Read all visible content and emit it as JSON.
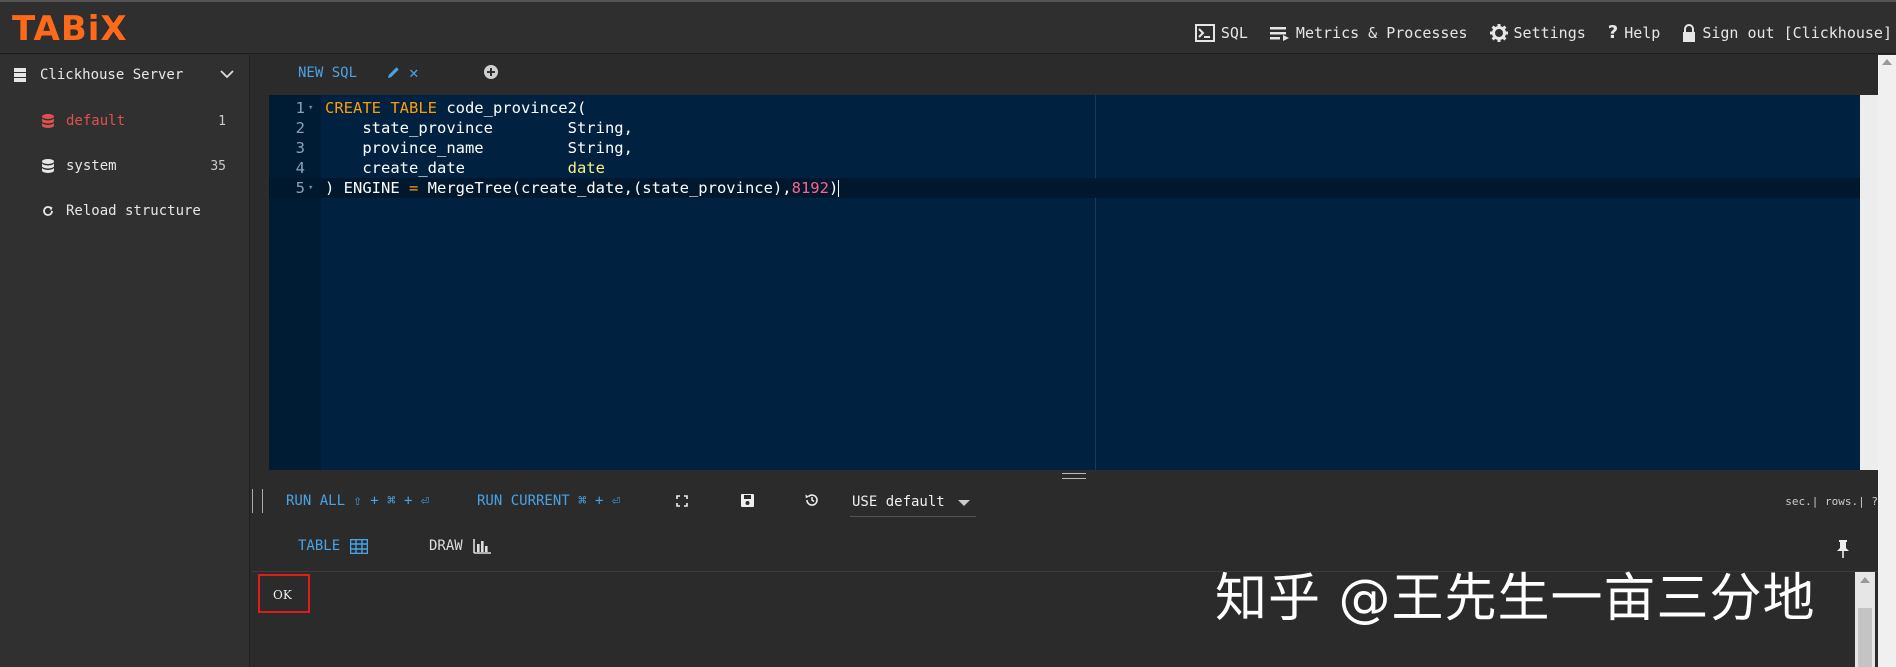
{
  "app": {
    "logo": "TABiX",
    "colors": {
      "brand": "#ff6a1a",
      "accent": "#4aa3e6",
      "danger": "#e05050",
      "editor_bg": "#002240"
    }
  },
  "topnav": {
    "sql": "SQL",
    "metrics": "Metrics & Processes",
    "settings": "Settings",
    "help": "Help",
    "signout": "Sign out [Clickhouse]"
  },
  "sidebar": {
    "server": "Clickhouse Server",
    "databases": [
      {
        "name": "default",
        "count": "1"
      },
      {
        "name": "system",
        "count": "35"
      }
    ],
    "reload": "Reload structure"
  },
  "tabs": {
    "active": "NEW SQL",
    "close": "✕"
  },
  "editor": {
    "line_numbers": [
      "1",
      "2",
      "3",
      "4",
      "5"
    ],
    "lines": [
      {
        "parts": [
          {
            "t": "CREATE TABLE",
            "c": "kw"
          },
          {
            "t": " code_province2(",
            "c": ""
          }
        ]
      },
      {
        "parts": [
          {
            "t": "    state_province        ",
            "c": ""
          },
          {
            "t": "String",
            "c": ""
          },
          {
            "t": ",",
            "c": ""
          }
        ]
      },
      {
        "parts": [
          {
            "t": "    province_name         ",
            "c": ""
          },
          {
            "t": "String",
            "c": ""
          },
          {
            "t": ",",
            "c": ""
          }
        ]
      },
      {
        "parts": [
          {
            "t": "    create_date           ",
            "c": ""
          },
          {
            "t": "date",
            "c": "ty"
          }
        ]
      },
      {
        "parts": [
          {
            "t": ") ENGINE ",
            "c": ""
          },
          {
            "t": "=",
            "c": "op"
          },
          {
            "t": " MergeTree(create_date,(state_province),",
            "c": ""
          },
          {
            "t": "8192",
            "c": "num-lit"
          },
          {
            "t": ")",
            "c": ""
          }
        ]
      }
    ]
  },
  "toolbar": {
    "run_all": "RUN ALL ⇧ + ⌘ + ⏎",
    "run_current": "RUN CURRENT ⌘ + ⏎",
    "use_db": "USE default",
    "stats": "sec.| rows.| ?"
  },
  "results": {
    "tab_table": "TABLE",
    "tab_draw": "DRAW",
    "status": "OK"
  },
  "watermark": "知乎 @王先生一亩三分地"
}
